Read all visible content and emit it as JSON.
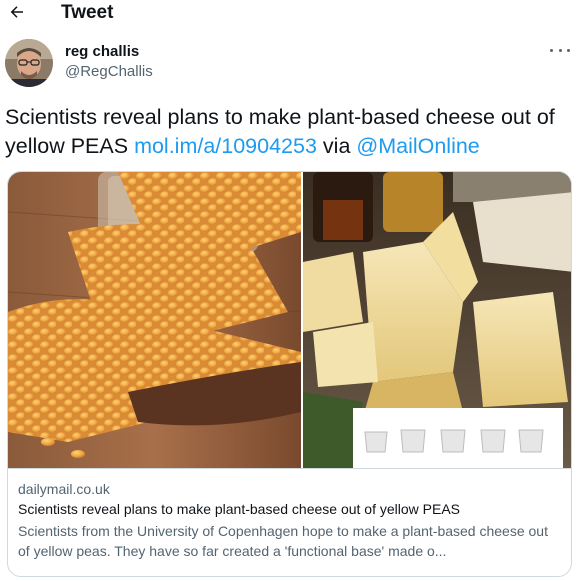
{
  "header": {
    "title": "Tweet",
    "back_icon": "arrow-left-icon"
  },
  "author": {
    "display_name": "reg challis",
    "handle": "@RegChallis",
    "more_icon": "more-horizontal-icon"
  },
  "tweet": {
    "text": "Scientists reveal plans to make plant-based cheese out of yellow PEAS ",
    "link_text": "mol.im/a/10904253",
    "via_text": " via ",
    "mention": "@MailOnline"
  },
  "card": {
    "domain": "dailymail.co.uk",
    "title": "Scientists reveal plans to make plant-based cheese out of yellow PEAS",
    "description": "Scientists from the University of Copenhagen  hope to make a plant-based cheese out of yellow peas. They have so far created a 'functional base' made o..."
  },
  "colors": {
    "link": "#1d9bf0",
    "secondary_text": "#536471",
    "border": "#cfd9de"
  }
}
